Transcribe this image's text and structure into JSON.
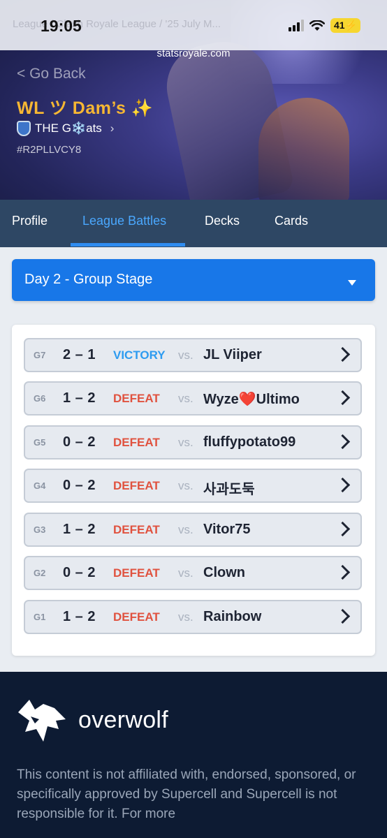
{
  "status_bar": {
    "time": "19:05",
    "background_breadcrumb": "League / Clash Royale League / '25 July M...",
    "battery": "41"
  },
  "browser": {
    "url": "statsroyale.com"
  },
  "header": {
    "back_label": "< Go Back",
    "player_name": "WL ツ Dam’s ✨",
    "clan_name": "THE G❄️ats",
    "clan_chevron": "›",
    "player_tag": "#R2PLLVCY8"
  },
  "tabs": [
    {
      "label": "Profile",
      "active": false
    },
    {
      "label": "League Battles",
      "active": true
    },
    {
      "label": "Decks",
      "active": false
    },
    {
      "label": "Cards",
      "active": false
    }
  ],
  "day_select": {
    "selected": "Day 2 - Group Stage"
  },
  "battles": [
    {
      "game": "G7",
      "score": "2 – 1",
      "result": "VICTORY",
      "vs": "vs.",
      "opponent": "JL Viiper"
    },
    {
      "game": "G6",
      "score": "1 – 2",
      "result": "DEFEAT",
      "vs": "vs.",
      "opponent": "Wyze❤️Ultimo"
    },
    {
      "game": "G5",
      "score": "0 – 2",
      "result": "DEFEAT",
      "vs": "vs.",
      "opponent": "fluffypotato99"
    },
    {
      "game": "G4",
      "score": "0 – 2",
      "result": "DEFEAT",
      "vs": "vs.",
      "opponent": "사과도둑"
    },
    {
      "game": "G3",
      "score": "1 – 2",
      "result": "DEFEAT",
      "vs": "vs.",
      "opponent": "Vitor75"
    },
    {
      "game": "G2",
      "score": "0 – 2",
      "result": "DEFEAT",
      "vs": "vs.",
      "opponent": "Clown"
    },
    {
      "game": "G1",
      "score": "1 – 2",
      "result": "DEFEAT",
      "vs": "vs.",
      "opponent": "Rainbow"
    }
  ],
  "footer": {
    "brand": "overwolf",
    "disclaimer": "This content is not affiliated with, endorsed, sponsored, or specifically approved by Supercell and Supercell is not responsible for it. For more"
  },
  "colors": {
    "accent": "#1877e8",
    "victory": "#2d9bf0",
    "defeat": "#e0523f",
    "player_name": "#f7b733",
    "tab_bar": "#2e4764",
    "footer": "#0d1b33"
  }
}
